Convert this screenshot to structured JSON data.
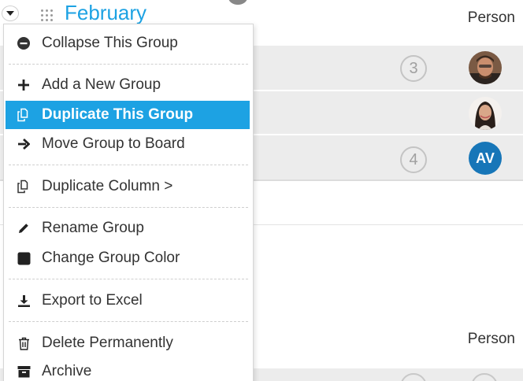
{
  "group": {
    "title": "February",
    "person_column_label": "Person"
  },
  "rows": [
    {
      "count": "3",
      "avatar": "photo-man"
    },
    {
      "count": "",
      "avatar": "photo-woman"
    },
    {
      "count": "4",
      "avatar_initials": "AV"
    }
  ],
  "second_group": {
    "person_column_label": "Person"
  },
  "colors": {
    "accent": "#1da2e3",
    "avatar_blue": "#1776b8",
    "row_bg": "#ececec"
  },
  "menu": {
    "items": [
      {
        "label": "Collapse This Group",
        "icon": "minus-circle-icon"
      },
      {
        "label": "Add a New Group",
        "icon": "plus-icon"
      },
      {
        "label": "Duplicate This Group",
        "icon": "duplicate-icon",
        "highlighted": true
      },
      {
        "label": "Move Group to Board",
        "icon": "arrow-right-icon"
      },
      {
        "label": "Duplicate Column >",
        "icon": "duplicate-icon"
      },
      {
        "label": "Rename Group",
        "icon": "pencil-icon"
      },
      {
        "label": "Change Group Color",
        "icon": "color-square-icon"
      },
      {
        "label": "Export to Excel",
        "icon": "download-icon"
      },
      {
        "label": "Delete Permanently",
        "icon": "trash-icon"
      },
      {
        "label": "Archive",
        "icon": "archive-box-icon"
      }
    ]
  }
}
